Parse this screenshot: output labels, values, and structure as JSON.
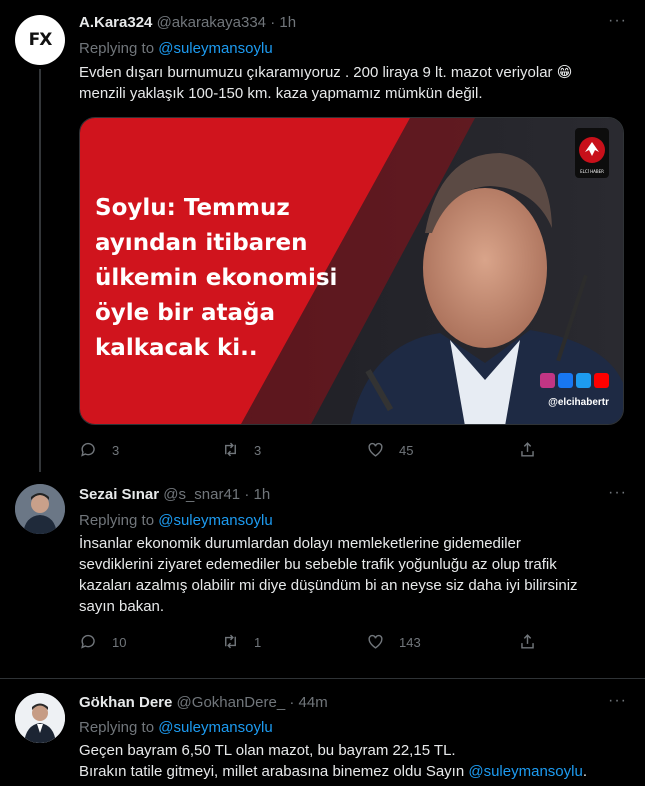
{
  "tweets": [
    {
      "name": "A.Kara324",
      "handle": "@akarakaya334",
      "dot": "·",
      "time": "1h",
      "avatar_text": "FX",
      "replying_prefix": "Replying to",
      "replying_to": "@suleymansoylu",
      "text_lines": [
        "Evden dışarı burnumuzu çıkaramıyoruz . 200 liraya 9 lt. mazot veriyolar 😁",
        "menzili yaklaşık 100-150 km. kaza yapmamız mümkün değil."
      ],
      "media": {
        "headline_lines": [
          "Soylu: Temmuz",
          "ayından itibaren",
          "ülkemin ekonomisi",
          "öyle bir atağa",
          "kalkacak ki.."
        ],
        "logo_text": "ELCİ HABER",
        "watermark": "@elcihabertr"
      },
      "stats": {
        "replies": "3",
        "retweets": "3",
        "likes": "45"
      }
    },
    {
      "name": "Sezai Sınar",
      "handle": "@s_snar41",
      "dot": "·",
      "time": "1h",
      "replying_prefix": "Replying to",
      "replying_to": "@suleymansoylu",
      "text_lines": [
        "İnsanlar ekonomik durumlardan dolayı memleketlerine gidemediler",
        "sevdiklerini ziyaret edemediler bu sebeble trafik yoğunluğu az olup trafik",
        "kazaları azalmış olabilir mi diye düşündüm bi an neyse siz daha iyi bilirsiniz",
        "sayın bakan."
      ],
      "stats": {
        "replies": "10",
        "retweets": "1",
        "likes": "143"
      }
    },
    {
      "name": "Gökhan Dere",
      "handle": "@GokhanDere_",
      "dot": "·",
      "time": "44m",
      "replying_prefix": "Replying to",
      "replying_to": "@suleymansoylu",
      "text_line1": "Geçen bayram 6,50 TL olan mazot, bu bayram 22,15 TL.",
      "text_line2_prefix": "Bırakın tatile gitmeyi, millet arabasına binemez oldu Sayın ",
      "text_line2_mention": "@suleymansoylu",
      "text_line2_suffix": "."
    }
  ],
  "more_icon": "···",
  "colors": {
    "accent": "#1d9bf0",
    "secondary": "#71767b",
    "background": "#000000",
    "media_red": "#d0141d"
  }
}
